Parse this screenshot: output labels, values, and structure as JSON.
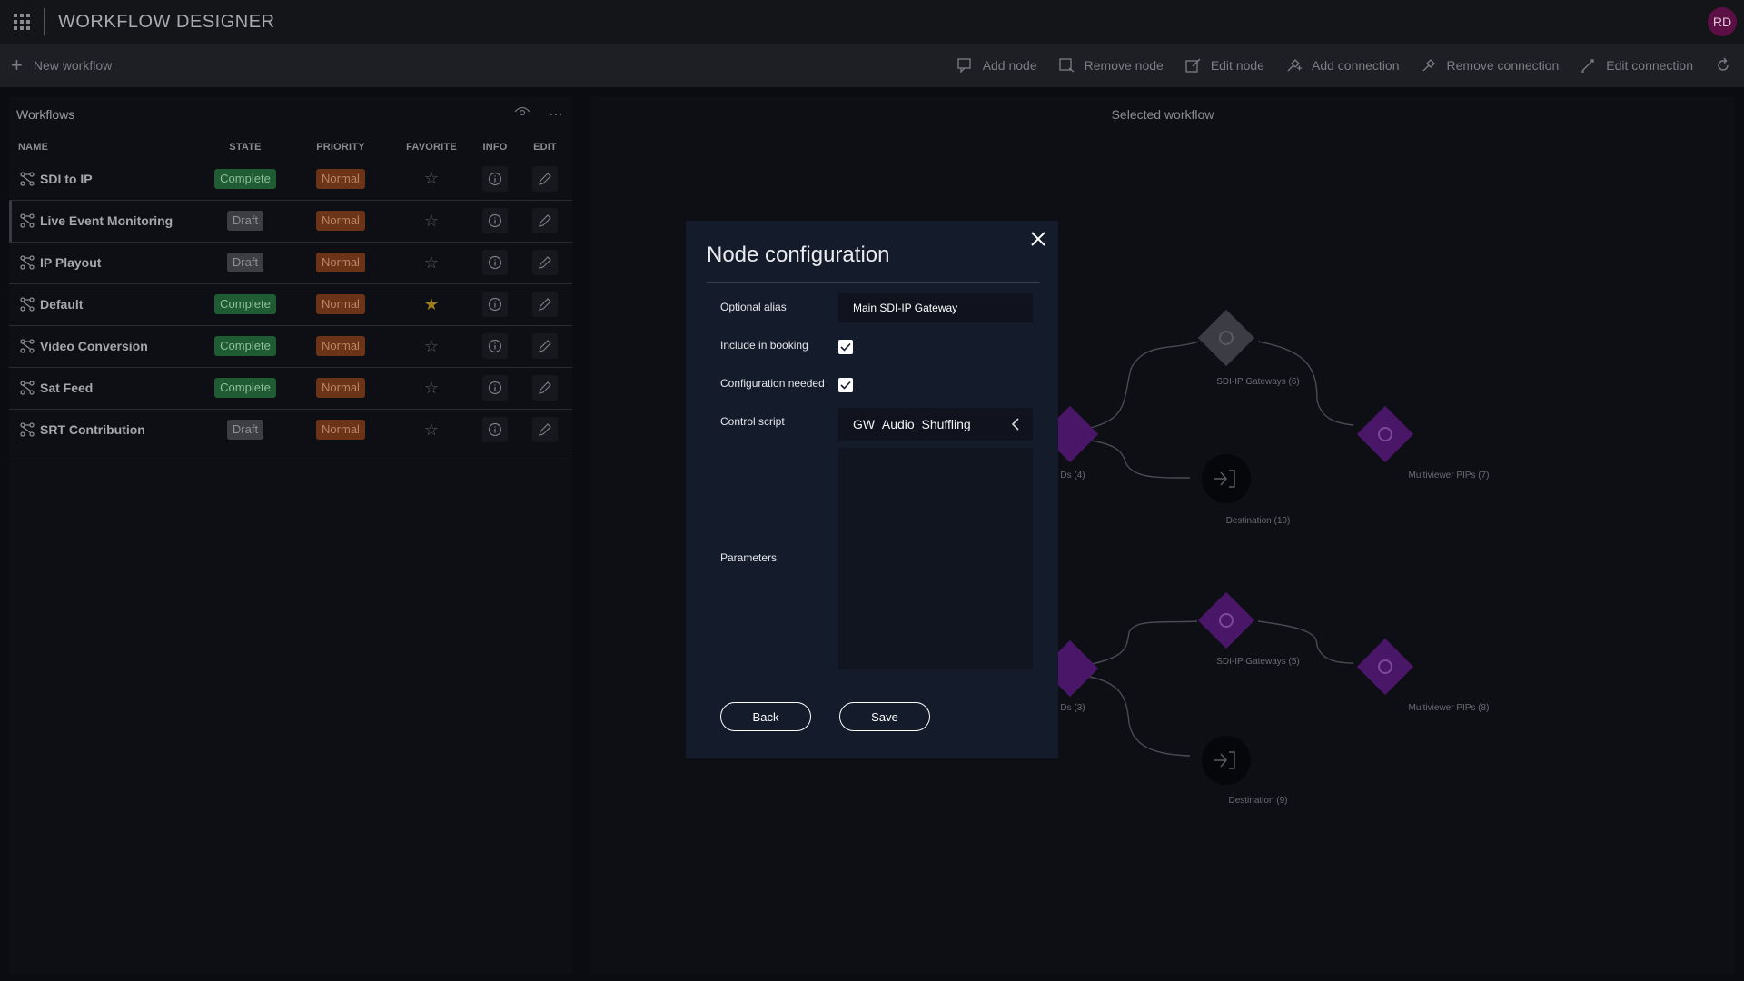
{
  "app": {
    "title": "WORKFLOW DESIGNER",
    "user_initials": "RD",
    "avatar_color": "#5b0f45"
  },
  "toolbar": {
    "new_workflow": "New workflow",
    "add_node": "Add node",
    "remove_node": "Remove node",
    "edit_node": "Edit node",
    "add_connection": "Add connection",
    "remove_connection": "Remove connection",
    "edit_connection": "Edit connection"
  },
  "workflows_panel": {
    "title": "Workflows",
    "columns": {
      "name": "NAME",
      "state": "STATE",
      "priority": "PRIORITY",
      "favorite": "FAVORITE",
      "info": "INFO",
      "edit": "EDIT"
    },
    "rows": [
      {
        "name": "SDI to IP",
        "state": "Complete",
        "priority": "Normal",
        "favorite": false
      },
      {
        "name": "Live Event Monitoring",
        "state": "Draft",
        "priority": "Normal",
        "favorite": false
      },
      {
        "name": "IP Playout",
        "state": "Draft",
        "priority": "Normal",
        "favorite": false
      },
      {
        "name": "Default",
        "state": "Complete",
        "priority": "Normal",
        "favorite": true
      },
      {
        "name": "Video Conversion",
        "state": "Complete",
        "priority": "Normal",
        "favorite": false
      },
      {
        "name": "Sat Feed",
        "state": "Complete",
        "priority": "Normal",
        "favorite": false
      },
      {
        "name": "SRT Contribution",
        "state": "Draft",
        "priority": "Normal",
        "favorite": false
      }
    ]
  },
  "selected_panel": {
    "title": "Selected workflow",
    "nodes": {
      "gw6": "SDI-IP Gateways (6)",
      "src4": "Ds (4)",
      "mv7": "Multiviewer PIPs (7)",
      "dest10": "Destination (10)",
      "gw5": "SDI-IP Gateways (5)",
      "src3": "Ds (3)",
      "mv8": "Multiviewer PIPs (8)",
      "dest9": "Destination (9)"
    }
  },
  "modal": {
    "title": "Node configuration",
    "alias_label": "Optional alias",
    "alias_value": "Main SDI-IP Gateway",
    "booking_label": "Include in booking",
    "booking_checked": true,
    "config_label": "Configuration needed",
    "config_checked": true,
    "script_label": "Control script",
    "script_value": "GW_Audio_Shuffling",
    "params_label": "Parameters",
    "back": "Back",
    "save": "Save"
  },
  "colors": {
    "complete": "#1f5b33",
    "draft": "#3d3e43",
    "normal": "#6b3419",
    "node_purple": "#4a1668",
    "modal_bg": "#141c2b"
  }
}
